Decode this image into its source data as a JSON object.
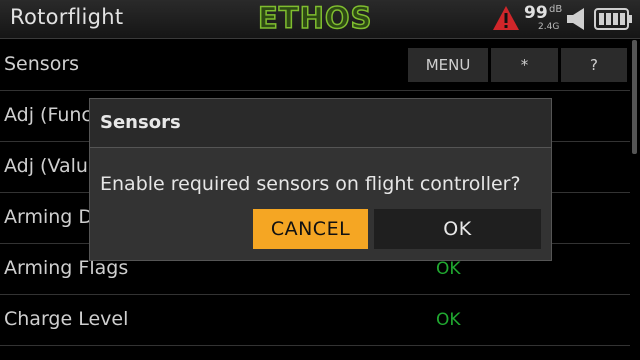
{
  "header": {
    "title": "Rotorflight",
    "logo": "ETHOS",
    "rssi_value": "99",
    "rssi_unit": "dB",
    "rssi_freq": "2.4G",
    "icons": [
      "warning-icon",
      "speaker-icon",
      "battery-icon"
    ]
  },
  "list": {
    "header_label": "Sensors",
    "buttons": [
      "MENU",
      "*",
      "?"
    ],
    "rows": [
      {
        "label": "Adj (Function)",
        "value": ""
      },
      {
        "label": "Adj (Value)",
        "value": ""
      },
      {
        "label": "Arming Disabled",
        "value": ""
      },
      {
        "label": "Arming Flags",
        "value": "OK"
      },
      {
        "label": "Charge Level",
        "value": "OK"
      }
    ]
  },
  "dialog": {
    "title": "Sensors",
    "message": "Enable required sensors on flight controller?",
    "cancel_label": "CANCEL",
    "ok_label": "OK"
  },
  "colors": {
    "accent": "#f5a623",
    "ok_green": "#20a830",
    "logo_green": "#7fbd2f",
    "warning_red": "#d0262a"
  }
}
